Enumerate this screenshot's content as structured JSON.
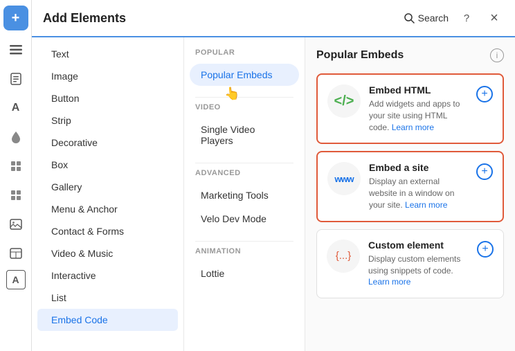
{
  "header": {
    "title": "Add Elements",
    "search_label": "Search",
    "close_label": "×",
    "help_label": "?"
  },
  "left_sidebar": {
    "icons": [
      {
        "name": "add",
        "label": "+",
        "active": false
      },
      {
        "name": "lines",
        "label": "≡",
        "active": false
      },
      {
        "name": "doc",
        "label": "◻",
        "active": false
      },
      {
        "name": "text-a",
        "label": "A",
        "active": false
      },
      {
        "name": "drop",
        "label": "◆",
        "active": false
      },
      {
        "name": "grid",
        "label": "⊞",
        "active": false
      },
      {
        "name": "puzzle",
        "label": "❖",
        "active": false
      },
      {
        "name": "image-frame",
        "label": "▣",
        "active": false
      },
      {
        "name": "table-alt",
        "label": "⊟",
        "active": false
      },
      {
        "name": "badge",
        "label": "🅰",
        "active": false
      }
    ]
  },
  "nav": {
    "items": [
      {
        "id": "text",
        "label": "Text"
      },
      {
        "id": "image",
        "label": "Image"
      },
      {
        "id": "button",
        "label": "Button"
      },
      {
        "id": "strip",
        "label": "Strip"
      },
      {
        "id": "decorative",
        "label": "Decorative"
      },
      {
        "id": "box",
        "label": "Box"
      },
      {
        "id": "gallery",
        "label": "Gallery"
      },
      {
        "id": "menu-anchor",
        "label": "Menu & Anchor"
      },
      {
        "id": "contact-forms",
        "label": "Contact & Forms"
      },
      {
        "id": "video-music",
        "label": "Video & Music"
      },
      {
        "id": "interactive",
        "label": "Interactive"
      },
      {
        "id": "list",
        "label": "List"
      },
      {
        "id": "embed-code",
        "label": "Embed Code",
        "active": true
      }
    ]
  },
  "middle": {
    "sections": [
      {
        "label": "POPULAR",
        "items": [
          {
            "id": "popular-embeds",
            "label": "Popular Embeds",
            "active": true
          }
        ]
      },
      {
        "label": "VIDEO",
        "items": [
          {
            "id": "single-video",
            "label": "Single Video Players"
          }
        ]
      },
      {
        "label": "ADVANCED",
        "items": [
          {
            "id": "marketing-tools",
            "label": "Marketing Tools"
          },
          {
            "id": "velo-dev-mode",
            "label": "Velo Dev Mode"
          }
        ]
      },
      {
        "label": "ANIMATION",
        "items": [
          {
            "id": "lottie",
            "label": "Lottie"
          }
        ]
      }
    ]
  },
  "right": {
    "title": "Popular Embeds",
    "cards": [
      {
        "id": "embed-html",
        "icon_text": "</>",
        "icon_type": "html",
        "title": "Embed HTML",
        "description": "Add widgets and apps to your site using HTML code.",
        "link_text": "Learn more",
        "highlighted": true
      },
      {
        "id": "embed-site",
        "icon_text": "www",
        "icon_type": "site",
        "title": "Embed a site",
        "description": "Display an external website in a window on your site.",
        "link_text": "Learn more",
        "highlighted": true
      },
      {
        "id": "custom-element",
        "icon_text": "{...}",
        "icon_type": "custom",
        "title": "Custom element",
        "description": "Display custom elements using snippets of code.",
        "link_text": "Learn more",
        "highlighted": false
      }
    ]
  },
  "colors": {
    "accent_blue": "#1a73e8",
    "accent_orange": "#e05a3a",
    "active_bg": "#e8f0fe",
    "highlighted_border": "#e05a3a",
    "green": "#4caf50"
  }
}
